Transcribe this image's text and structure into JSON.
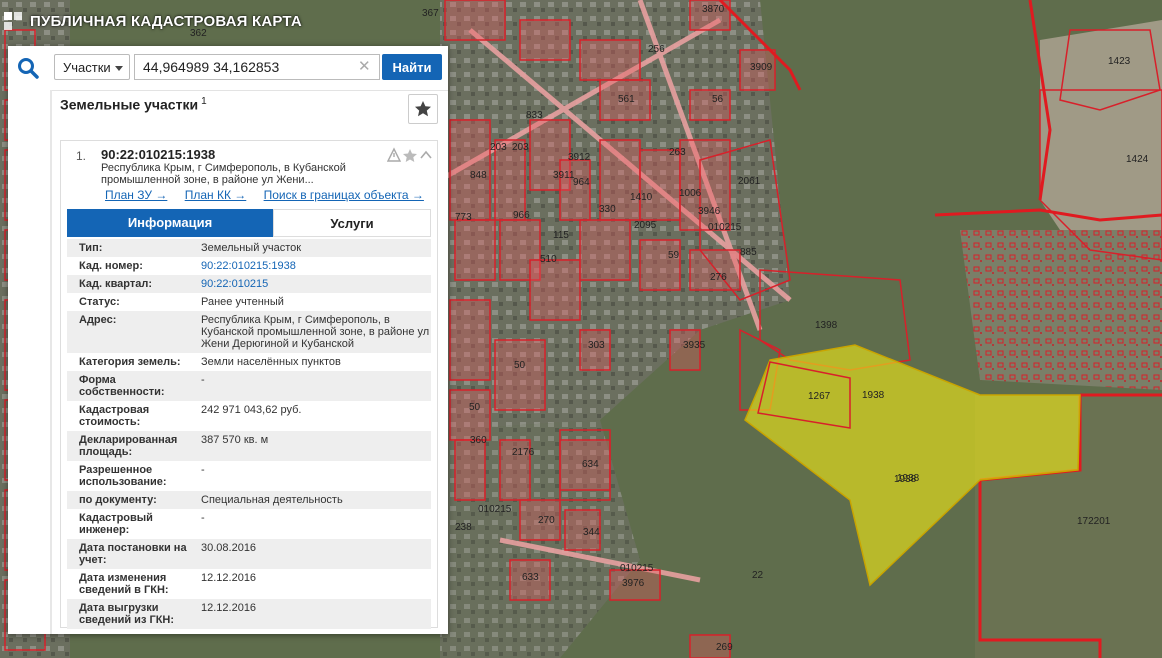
{
  "app": {
    "title": "ПУБЛИЧНАЯ КАДАСТРОВАЯ КАРТА"
  },
  "search": {
    "type_label": "Участки",
    "query": "44,964989 34,162853",
    "find_label": "Найти"
  },
  "results": {
    "header": "Земельные участки",
    "count": "1",
    "items": [
      {
        "index": "1.",
        "cad_number": "90:22:010215:1938",
        "address_short": "Республика Крым, г Симферополь, в Кубанской промышленной зоне, в районе ул Жени...",
        "links": [
          "План ЗУ →",
          "План КК →",
          "Поиск в границах объекта →"
        ],
        "tabs": [
          "Информация",
          "Услуги"
        ],
        "fields": [
          {
            "k": "Тип:",
            "v": "Земельный участок"
          },
          {
            "k": "Кад. номер:",
            "v": "90:22:010215:1938"
          },
          {
            "k": "Кад. квартал:",
            "v": "90:22:010215"
          },
          {
            "k": "Статус:",
            "v": "Ранее учтенный"
          },
          {
            "k": "Адрес:",
            "v": "Республика Крым, г Симферополь, в Кубанской промышленной зоне, в районе ул Жени Дерюгиной и Кубанской"
          },
          {
            "k": "Категория земель:",
            "v": "Земли населённых пунктов"
          },
          {
            "k": "Форма собственности:",
            "v": "-"
          },
          {
            "k": "Кадастровая стоимость:",
            "v": "242 971 043,62 руб."
          },
          {
            "k": "Декларированная площадь:",
            "v": "387 570 кв. м"
          },
          {
            "k": "Разрешенное использование:",
            "v": "-"
          },
          {
            "k": "по документу:",
            "v": "Специальная деятельность"
          },
          {
            "k": "Кадастровый инженер:",
            "v": "-"
          },
          {
            "k": "Дата постановки на учет:",
            "v": "30.08.2016"
          },
          {
            "k": "Дата изменения сведений в ГКН:",
            "v": "12.12.2016"
          },
          {
            "k": "Дата выгрузки сведений из ГКН:",
            "v": "12.12.2016"
          }
        ]
      }
    ]
  },
  "map": {
    "labels": [
      "367",
      "362",
      "3870",
      "256",
      "3909",
      "1423",
      "561",
      "56",
      "833",
      "203",
      "203",
      "2061",
      "1424",
      "3912",
      "1006",
      "3911",
      "964",
      "1410",
      "263",
      "3946",
      "010215",
      "848",
      "966",
      "330",
      "2095",
      "773",
      "115",
      "510",
      "59",
      "276",
      "885",
      "2552",
      "010204",
      "1398",
      "1938",
      "1267",
      "1938",
      "3935",
      "303",
      "50",
      "50",
      "360",
      "2176",
      "634",
      "1938",
      "010215",
      "238",
      "270",
      "344",
      "172201",
      "633",
      "3976",
      "010215",
      "22",
      "269"
    ],
    "colors": {
      "parcel_stroke": "#d8202a",
      "parcel_fill": "#e85a5f",
      "selected_fill": "#e8e21a"
    }
  }
}
